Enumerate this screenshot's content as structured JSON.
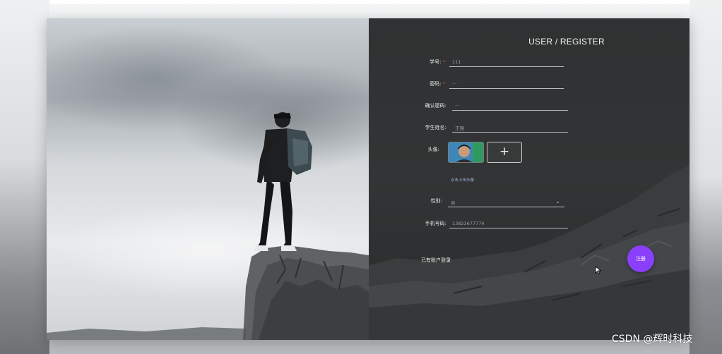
{
  "form": {
    "title": "USER / REGISTER",
    "fields": [
      {
        "label": "学号:",
        "required": true,
        "value": "111"
      },
      {
        "label": "密码:",
        "required": true,
        "value": "···"
      },
      {
        "label": "确认密码:",
        "required": false,
        "value": "···"
      },
      {
        "label": "学生姓名:",
        "required": false,
        "value": "王强"
      }
    ],
    "avatar": {
      "label": "头像:",
      "upload_symbol": "+",
      "hint": "点击上传头像"
    },
    "gender": {
      "label": "性别:",
      "value": "男"
    },
    "phone": {
      "label": "手机号码:",
      "value": "13823677774"
    },
    "login_link": "已有账户登录",
    "register_button": "注册",
    "required_mark": "*"
  },
  "icons": {
    "chevron": "chevron-down-icon",
    "plus": "plus-icon",
    "cursor": "mouse-pointer-icon"
  },
  "colors": {
    "panel": "#2f3132",
    "accent": "#8a3ffc",
    "required": "#e0474c",
    "hint": "#9fb2d6"
  },
  "watermark": "CSDN @辉时科技"
}
